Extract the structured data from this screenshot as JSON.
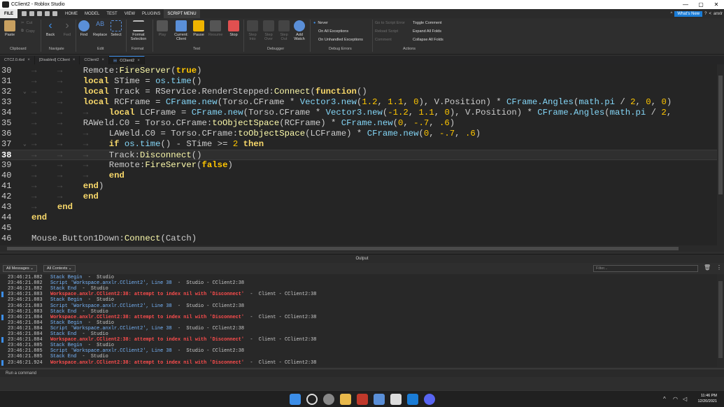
{
  "window": {
    "title": "CClient2 - Roblox Studio",
    "controls": [
      "—",
      "▢",
      "✕"
    ]
  },
  "menubar": {
    "file": "FILE",
    "tabs": [
      "HOME",
      "MODEL",
      "TEST",
      "VIEW",
      "PLUGINS",
      "SCRIPT MENU"
    ],
    "whats_new": "What's New",
    "user": "anxlr"
  },
  "ribbon": {
    "paste": "Paste",
    "cut": "Cut",
    "copy": "Copy",
    "clipboard": "Clipboard",
    "back": "Back",
    "fwd": "Fwd",
    "navigate": "Navigate",
    "find": "Find",
    "replace": "Replace",
    "select": "Select",
    "edit": "Edit",
    "format_selection": "Format\nSelection",
    "format": "Format",
    "play": "Play",
    "current_client": "Current:\nClient",
    "pause": "Pause",
    "resume": "Resume",
    "stop": "Stop",
    "test": "Test",
    "step_into": "Step\nInto",
    "step_over": "Step\nOver",
    "step_out": "Step\nOut",
    "add_watch": "Add\nWatch",
    "debugger": "Debugger",
    "never": "Never",
    "on_all_exceptions": "On All Exceptions",
    "on_unhandled_exceptions": "On Unhandled Exceptions",
    "debug_errors": "Debug Errors",
    "go_to_script_error": "Go to Script Error",
    "reload_script": "Reload Script",
    "comment": "Comment",
    "toggle_comment": "Toggle Comment",
    "expand_all_folds": "Expand All Folds",
    "collapse_all_folds": "Collapse All Folds",
    "actions": "Actions"
  },
  "doc_tabs": [
    {
      "label": "CTC2.0.rbxl"
    },
    {
      "label": "[Disabled] CClient"
    },
    {
      "label": "CClient2"
    },
    {
      "label": "CClient2",
      "active": true
    }
  ],
  "editor": {
    "current_line": 38,
    "lines": [
      {
        "n": "30",
        "tabs": "→    →    ",
        "html": "Remote:<span class='fn'>FireServer</span>(<span class='bool'>true</span>)"
      },
      {
        "n": "31",
        "tabs": "→    →    ",
        "html": "<span class='kw'>local</span> STime = <span class='bi'>os.time</span>()"
      },
      {
        "n": "32",
        "tabs": "→    →    ",
        "fold": "⌄",
        "html": "<span class='kw'>local</span> Track = RService.RenderStepped:<span class='fn'>Connect</span>(<span class='kw'>function</span>()"
      },
      {
        "n": "33",
        "tabs": "→    →    ",
        "html": "<span class='kw'>local</span> RCFrame = <span class='bi'>CFrame.new</span>(Torso.CFrame * <span class='bi'>Vector3.new</span>(<span class='num'>1.2</span>, <span class='num'>1.1</span>, <span class='num'>0</span>), V.Position) * <span class='bi'>CFrame.Angles</span>(<span class='bi'>math.pi</span> / <span class='num'>2</span>, <span class='num'>0</span>, <span class='num'>0</span>)"
      },
      {
        "n": "34",
        "tabs": "→    →    →    ",
        "html": "<span class='kw'>local</span> LCFrame = <span class='bi'>CFrame.new</span>(Torso.CFrame * <span class='bi'>Vector3.new</span>(<span class='num'>-1.2</span>, <span class='num'>1.1</span>, <span class='num'>0</span>), V.Position) * <span class='bi'>CFrame.Angles</span>(<span class='bi'>math.pi</span> / <span class='num'>2</span>,"
      },
      {
        "n": "35",
        "tabs": "→    →    ",
        "html": "RAWeld.C0 = Torso.CFrame:<span class='fn'>toObjectSpace</span>(RCFrame) * <span class='bi'>CFrame.new</span>(<span class='num'>0</span>, <span class='num'>-.7</span>, <span class='num'>.6</span>)"
      },
      {
        "n": "36",
        "tabs": "→    →    →    ",
        "html": "LAWeld.C0 = Torso.CFrame:<span class='fn'>toObjectSpace</span>(LCFrame) * <span class='bi'>CFrame.new</span>(<span class='num'>0</span>, <span class='num'>-.7</span>, <span class='num'>.6</span>)"
      },
      {
        "n": "37",
        "tabs": "→    →    →    ",
        "fold": "⌄",
        "html": "<span class='kw'>if</span> <span class='bi'>os.time</span>() - STime >= <span class='num'>2</span> <span class='kw'>then</span>"
      },
      {
        "n": "38",
        "tabs": "→    →    →    ",
        "html": "Track:<span class='fn'>Disconnect</span>()"
      },
      {
        "n": "39",
        "tabs": "→    →    →    ",
        "html": "Remote:<span class='fn'>FireServer</span>(<span class='bool'>false</span>)"
      },
      {
        "n": "40",
        "tabs": "→    →    →    ",
        "html": "<span class='kw'>end</span>"
      },
      {
        "n": "41",
        "tabs": "→    →    ",
        "html": "<span class='kw'>end</span>)"
      },
      {
        "n": "42",
        "tabs": "→    →    ",
        "html": "<span class='kw'>end</span>"
      },
      {
        "n": "43",
        "tabs": "→    ",
        "html": "<span class='kw'>end</span>"
      },
      {
        "n": "44",
        "tabs": "",
        "html": "<span class='kw'>end</span>"
      },
      {
        "n": "45",
        "tabs": "",
        "html": ""
      },
      {
        "n": "46",
        "tabs": "",
        "html": "Mouse.Button1Down:<span class='fn'>Connect</span>(Catch)"
      }
    ]
  },
  "output": {
    "title": "Output",
    "all_messages": "All Messages",
    "all_contexts": "All Contexts",
    "filter_placeholder": "Filter...",
    "entries": [
      {
        "t": "23:46:21.882",
        "type": "info",
        "msg": "Stack Begin",
        "src": "  -  Studio"
      },
      {
        "t": "23:46:21.882",
        "type": "info",
        "msg": "Script 'Workspace.anxlr.CClient2', Line 38",
        "src": "  -  Studio - CClient2:38"
      },
      {
        "t": "23:46:21.882",
        "type": "info",
        "msg": "Stack End",
        "src": "  -  Studio"
      },
      {
        "t": "23:46:21.883",
        "type": "err",
        "msg": "Workspace.anxlr.CClient2:38: attempt to index nil with 'Disconnect'",
        "src": "  -  Client - CClient2:38"
      },
      {
        "t": "23:46:21.883",
        "type": "info",
        "msg": "Stack Begin",
        "src": "  -  Studio"
      },
      {
        "t": "23:46:21.883",
        "type": "info",
        "msg": "Script 'Workspace.anxlr.CClient2', Line 38",
        "src": "  -  Studio - CClient2:38"
      },
      {
        "t": "23:46:21.883",
        "type": "info",
        "msg": "Stack End",
        "src": "  -  Studio"
      },
      {
        "t": "23:46:21.884",
        "type": "err",
        "msg": "Workspace.anxlr.CClient2:38: attempt to index nil with 'Disconnect'",
        "src": "  -  Client - CClient2:38"
      },
      {
        "t": "23:46:21.884",
        "type": "info",
        "msg": "Stack Begin",
        "src": "  -  Studio"
      },
      {
        "t": "23:46:21.884",
        "type": "info",
        "msg": "Script 'Workspace.anxlr.CClient2', Line 38",
        "src": "  -  Studio - CClient2:38"
      },
      {
        "t": "23:46:21.884",
        "type": "info",
        "msg": "Stack End",
        "src": "  -  Studio"
      },
      {
        "t": "23:46:21.884",
        "type": "err",
        "msg": "Workspace.anxlr.CClient2:38: attempt to index nil with 'Disconnect'",
        "src": "  -  Client - CClient2:38"
      },
      {
        "t": "23:46:21.885",
        "type": "info",
        "msg": "Stack Begin",
        "src": "  -  Studio"
      },
      {
        "t": "23:46:21.885",
        "type": "info",
        "msg": "Script 'Workspace.anxlr.CClient2', Line 38",
        "src": "  -  Studio - CClient2:38"
      },
      {
        "t": "23:46:21.885",
        "type": "info",
        "msg": "Stack End",
        "src": "  -  Studio"
      },
      {
        "t": "23:46:21.924",
        "type": "err",
        "msg": "Workspace.anxlr.CClient2:38: attempt to index nil with 'Disconnect'",
        "src": "  -  Client - CClient2:38"
      }
    ],
    "command_placeholder": "Run a command"
  },
  "taskbar": {
    "time": "11:46 PM",
    "date": "12/20/2021"
  },
  "colors": {
    "accent": "#3c8ee8",
    "error": "#ff4d4d",
    "keyword": "#f8d86a",
    "builtin": "#84d6f7",
    "number": "#ffc600"
  }
}
